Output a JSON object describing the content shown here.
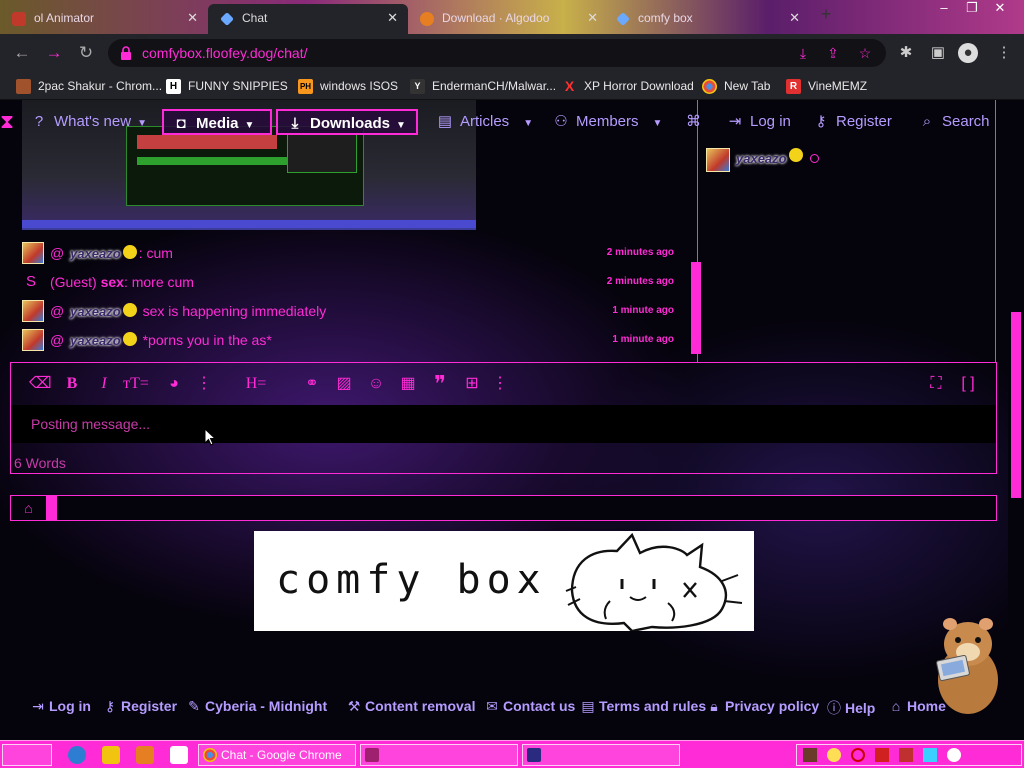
{
  "browser": {
    "tabs": [
      {
        "label": "ol Animator",
        "active": false
      },
      {
        "label": "Chat",
        "active": true
      },
      {
        "label": "Download · Algodoo",
        "active": false
      },
      {
        "label": "comfy box",
        "active": false
      }
    ],
    "url": "comfybox.floofey.dog/chat/",
    "bookmarks": [
      {
        "label": "2pac Shakur - Chrom...",
        "icon": "tupac-icon"
      },
      {
        "label": "FUNNY SNIPPIES",
        "icon": "h-icon",
        "glyph": "H"
      },
      {
        "label": "windows ISOS",
        "icon": "ph-icon",
        "glyph": "PH"
      },
      {
        "label": "EndermanCH/Malwar...",
        "icon": "github-icon",
        "glyph": "Y"
      },
      {
        "label": "XP Horror Download",
        "icon": "x-icon",
        "glyph": "X"
      },
      {
        "label": "New Tab",
        "icon": "chrome-icon"
      },
      {
        "label": "VineMEMZ",
        "icon": "r-icon",
        "glyph": "R"
      }
    ]
  },
  "nav": {
    "whats_new": "What's new",
    "media": "Media",
    "downloads": "Downloads",
    "articles": "Articles",
    "members": "Members",
    "login": "Log in",
    "register": "Register",
    "search": "Search"
  },
  "chat": {
    "messages": [
      {
        "user": "yaxeazo",
        "text": "cum",
        "time": "2 minutes ago",
        "guest": false
      },
      {
        "user": "sex",
        "text": "more cum",
        "time": "2 minutes ago",
        "guest": true,
        "guest_label": "(Guest)"
      },
      {
        "user": "yaxeazo",
        "text": "sex is happening immediately",
        "time": "1 minute ago",
        "guest": false
      },
      {
        "user": "yaxeazo",
        "text": "*porns you in the as*",
        "time": "1 minute ago",
        "guest": false
      }
    ],
    "at_sign": "@",
    "guest_avatar_letter": "S"
  },
  "members_panel": {
    "users": [
      {
        "name": "yaxeazo"
      }
    ]
  },
  "editor": {
    "placeholder": "Posting message...",
    "word_count": "6 Words"
  },
  "logo": {
    "text": "comfy box"
  },
  "footer": {
    "links": [
      {
        "label": "Log in"
      },
      {
        "label": "Register"
      },
      {
        "label": "Cyberia - Midnight"
      },
      {
        "label": "Content removal"
      },
      {
        "label": "Contact us"
      },
      {
        "label": "Terms and rules"
      },
      {
        "label": "Privacy policy"
      },
      {
        "label": "Help"
      },
      {
        "label": "Home"
      }
    ]
  },
  "taskbar": {
    "buttons": [
      {
        "label": "Chat - Google Chrome"
      },
      {
        "label": ""
      },
      {
        "label": ""
      }
    ]
  },
  "colors": {
    "accent": "#ff2bd6",
    "nav_text": "#b59cff",
    "background": "#05030c"
  }
}
